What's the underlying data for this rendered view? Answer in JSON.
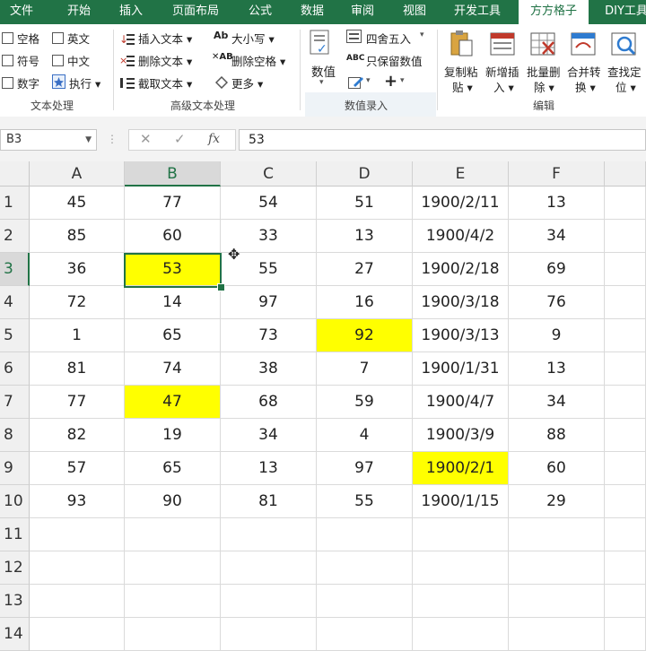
{
  "tabs": [
    "文件",
    "开始",
    "插入",
    "页面布局",
    "公式",
    "数据",
    "审阅",
    "视图",
    "开发工具",
    "方方格子",
    "DIY工具"
  ],
  "active_tab": "方方格子",
  "ribbon": {
    "text_group": {
      "checkboxes": [
        "空格",
        "英文",
        "符号",
        "中文",
        "数字"
      ],
      "execute": "执行",
      "label": "文本处理"
    },
    "advanced_group": {
      "insert_text": "插入文本",
      "delete_text": "删除文本",
      "cut_text": "截取文本",
      "case": "大小写",
      "delete_space": "删除空格",
      "more": "更多",
      "label": "高级文本处理"
    },
    "value_group": {
      "value": "数值",
      "round": "四舍五入",
      "keep_value": "只保留数值",
      "label": "数值录入"
    },
    "edit_group": {
      "copy_paste": [
        "复制粘",
        "贴"
      ],
      "add_insert": [
        "新增插",
        "入"
      ],
      "batch_delete": [
        "批量删",
        "除"
      ],
      "merge_convert": [
        "合并转",
        "换"
      ],
      "find_locate": [
        "查找定",
        "位"
      ],
      "label": "编辑"
    }
  },
  "formula_bar": {
    "name_box": "B3",
    "fx": "fx",
    "value": "53"
  },
  "sheet": {
    "columns": [
      "A",
      "B",
      "C",
      "D",
      "E",
      "F"
    ],
    "rows": [
      [
        "45",
        "77",
        "54",
        "51",
        "1900/2/11",
        "13"
      ],
      [
        "85",
        "60",
        "33",
        "13",
        "1900/4/2",
        "34"
      ],
      [
        "36",
        "53",
        "55",
        "27",
        "1900/2/18",
        "69"
      ],
      [
        "72",
        "14",
        "97",
        "16",
        "1900/3/18",
        "76"
      ],
      [
        "1",
        "65",
        "73",
        "92",
        "1900/3/13",
        "9"
      ],
      [
        "81",
        "74",
        "38",
        "7",
        "1900/1/31",
        "13"
      ],
      [
        "77",
        "47",
        "68",
        "59",
        "1900/4/7",
        "34"
      ],
      [
        "82",
        "19",
        "34",
        "4",
        "1900/3/9",
        "88"
      ],
      [
        "57",
        "65",
        "13",
        "97",
        "1900/2/1",
        "60"
      ],
      [
        "93",
        "90",
        "81",
        "55",
        "1900/1/15",
        "29"
      ],
      [
        "",
        "",
        "",
        "",
        "",
        ""
      ],
      [
        "",
        "",
        "",
        "",
        "",
        ""
      ],
      [
        "",
        "",
        "",
        "",
        "",
        ""
      ],
      [
        "",
        "",
        "",
        "",
        "",
        ""
      ]
    ],
    "row_numbers": [
      "1",
      "2",
      "3",
      "4",
      "5",
      "6",
      "7",
      "8",
      "9",
      "10",
      "11",
      "12",
      "13",
      "14"
    ],
    "highlighted": [
      [
        2,
        1
      ],
      [
        4,
        3
      ],
      [
        6,
        1
      ],
      [
        8,
        4
      ]
    ],
    "selected_cell": "B3",
    "highlight_color": "#ffff00",
    "accent_color": "#217346"
  }
}
